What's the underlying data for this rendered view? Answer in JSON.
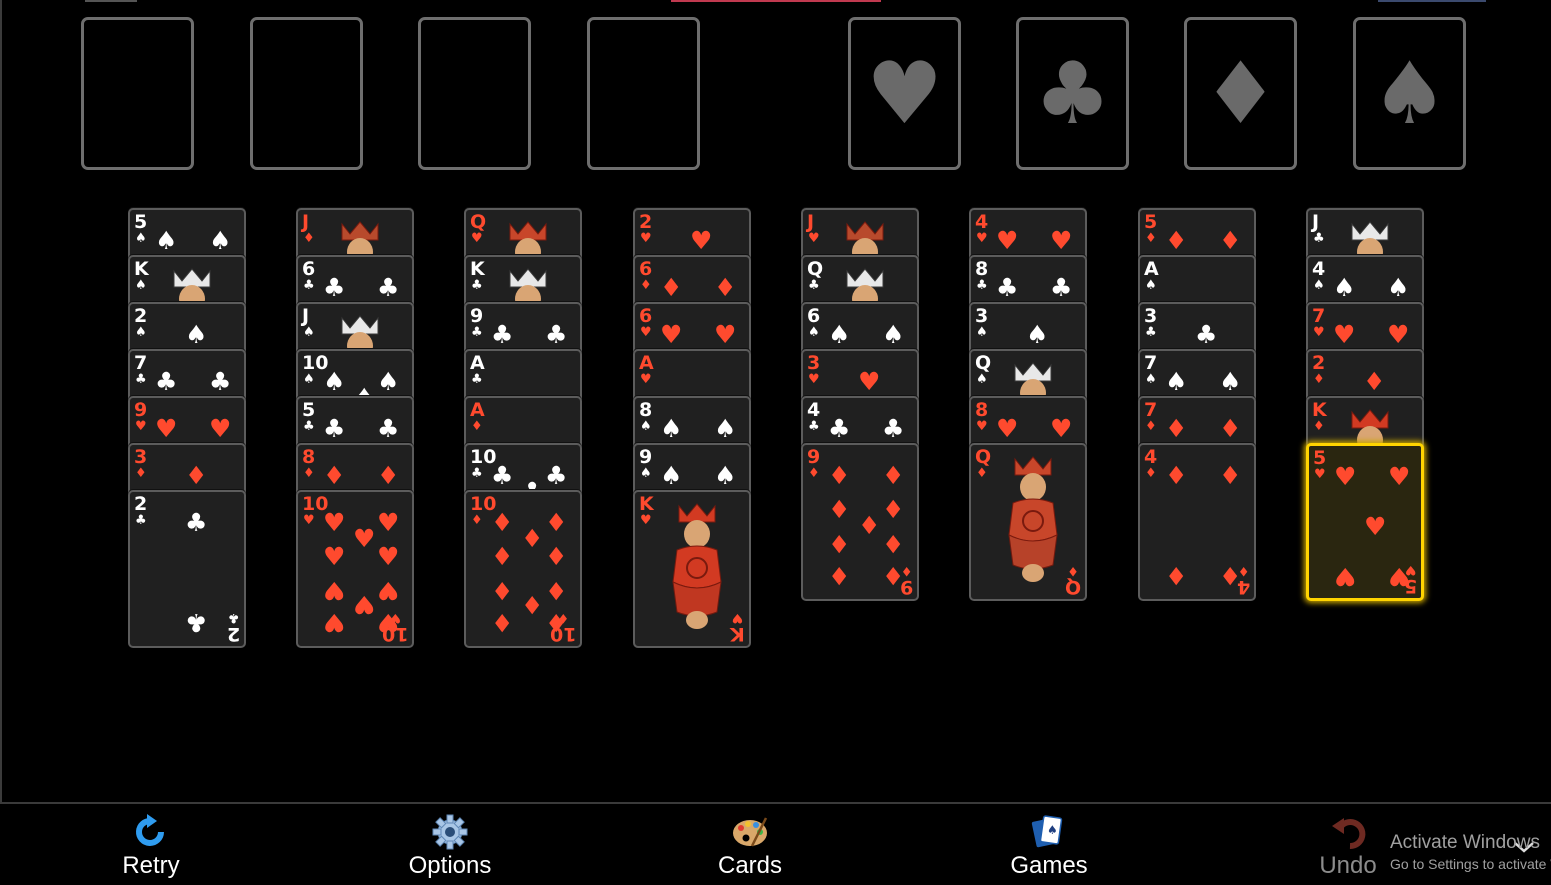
{
  "freecells": [
    {
      "name": "freecell-1"
    },
    {
      "name": "freecell-2"
    },
    {
      "name": "freecell-3"
    },
    {
      "name": "freecell-4"
    }
  ],
  "foundations": [
    {
      "suit": "hearts",
      "glyph": "♥",
      "icon": "heart-icon"
    },
    {
      "suit": "clubs",
      "glyph": "♣",
      "icon": "club-icon"
    },
    {
      "suit": "diamonds",
      "glyph": "♦",
      "icon": "diamond-icon"
    },
    {
      "suit": "spades",
      "glyph": "♠",
      "icon": "spade-icon"
    }
  ],
  "tableau": [
    [
      {
        "r": "5",
        "s": "♠"
      },
      {
        "r": "K",
        "s": "♠"
      },
      {
        "r": "2",
        "s": "♠"
      },
      {
        "r": "7",
        "s": "♣"
      },
      {
        "r": "9",
        "s": "♥"
      },
      {
        "r": "3",
        "s": "♦"
      },
      {
        "r": "2",
        "s": "♣"
      }
    ],
    [
      {
        "r": "J",
        "s": "♦"
      },
      {
        "r": "6",
        "s": "♣"
      },
      {
        "r": "J",
        "s": "♠"
      },
      {
        "r": "10",
        "s": "♠"
      },
      {
        "r": "5",
        "s": "♣"
      },
      {
        "r": "8",
        "s": "♦"
      },
      {
        "r": "10",
        "s": "♥"
      }
    ],
    [
      {
        "r": "Q",
        "s": "♥"
      },
      {
        "r": "K",
        "s": "♣"
      },
      {
        "r": "9",
        "s": "♣"
      },
      {
        "r": "A",
        "s": "♣"
      },
      {
        "r": "A",
        "s": "♦"
      },
      {
        "r": "10",
        "s": "♣"
      },
      {
        "r": "10",
        "s": "♦"
      }
    ],
    [
      {
        "r": "2",
        "s": "♥"
      },
      {
        "r": "6",
        "s": "♦"
      },
      {
        "r": "6",
        "s": "♥"
      },
      {
        "r": "A",
        "s": "♥"
      },
      {
        "r": "8",
        "s": "♠"
      },
      {
        "r": "9",
        "s": "♠"
      },
      {
        "r": "K",
        "s": "♥"
      }
    ],
    [
      {
        "r": "J",
        "s": "♥"
      },
      {
        "r": "Q",
        "s": "♣"
      },
      {
        "r": "6",
        "s": "♠"
      },
      {
        "r": "3",
        "s": "♥"
      },
      {
        "r": "4",
        "s": "♣"
      },
      {
        "r": "9",
        "s": "♦"
      }
    ],
    [
      {
        "r": "4",
        "s": "♥"
      },
      {
        "r": "8",
        "s": "♣"
      },
      {
        "r": "3",
        "s": "♠"
      },
      {
        "r": "Q",
        "s": "♠"
      },
      {
        "r": "8",
        "s": "♥"
      },
      {
        "r": "Q",
        "s": "♦"
      }
    ],
    [
      {
        "r": "5",
        "s": "♦"
      },
      {
        "r": "A",
        "s": "♠"
      },
      {
        "r": "3",
        "s": "♣"
      },
      {
        "r": "7",
        "s": "♠"
      },
      {
        "r": "7",
        "s": "♦"
      },
      {
        "r": "4",
        "s": "♦"
      }
    ],
    [
      {
        "r": "J",
        "s": "♣"
      },
      {
        "r": "4",
        "s": "♠"
      },
      {
        "r": "7",
        "s": "♥"
      },
      {
        "r": "2",
        "s": "♦"
      },
      {
        "r": "K",
        "s": "♦"
      },
      {
        "r": "5",
        "s": "♥",
        "selected": true
      }
    ]
  ],
  "toolbar": {
    "retry": "Retry",
    "options": "Options",
    "cards": "Cards",
    "games": "Games",
    "undo": "Undo"
  },
  "watermark": {
    "line1": "Activate Windows",
    "line2": "Go to Settings to activate Windows."
  },
  "colors": {
    "red": "#ff4a2e",
    "highlight": "#ffd400",
    "slot": "#6e6e6e"
  }
}
